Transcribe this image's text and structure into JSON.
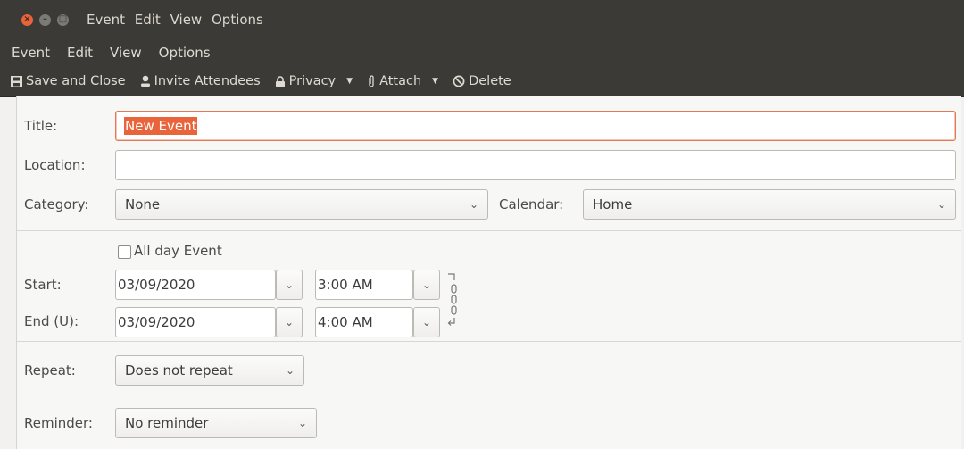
{
  "window": {
    "title_menu": [
      "Event",
      "Edit",
      "View",
      "Options"
    ]
  },
  "menubar": {
    "items": [
      "Event",
      "Edit",
      "View",
      "Options"
    ]
  },
  "toolbar": {
    "save_close": "Save and Close",
    "invite": "Invite Attendees",
    "privacy": "Privacy",
    "attach": "Attach",
    "delete": "Delete"
  },
  "form": {
    "title_label": "Title:",
    "title_value": "New Event",
    "location_label": "Location:",
    "location_value": "",
    "category_label": "Category:",
    "category_value": "None",
    "calendar_label": "Calendar:",
    "calendar_value": "Home",
    "allday_label": "All day Event",
    "start_label": "Start:",
    "start_date": "03/09/2020",
    "start_time": "3:00 AM",
    "end_label": "End (U):",
    "end_date": "03/09/2020",
    "end_time": "4:00 AM",
    "repeat_label": "Repeat:",
    "repeat_value": "Does not repeat",
    "reminder_label": "Reminder:",
    "reminder_value": "No reminder"
  },
  "colors": {
    "chrome": "#3b3a36",
    "accent": "#e9643a",
    "form_bg": "#f7f7f6"
  }
}
